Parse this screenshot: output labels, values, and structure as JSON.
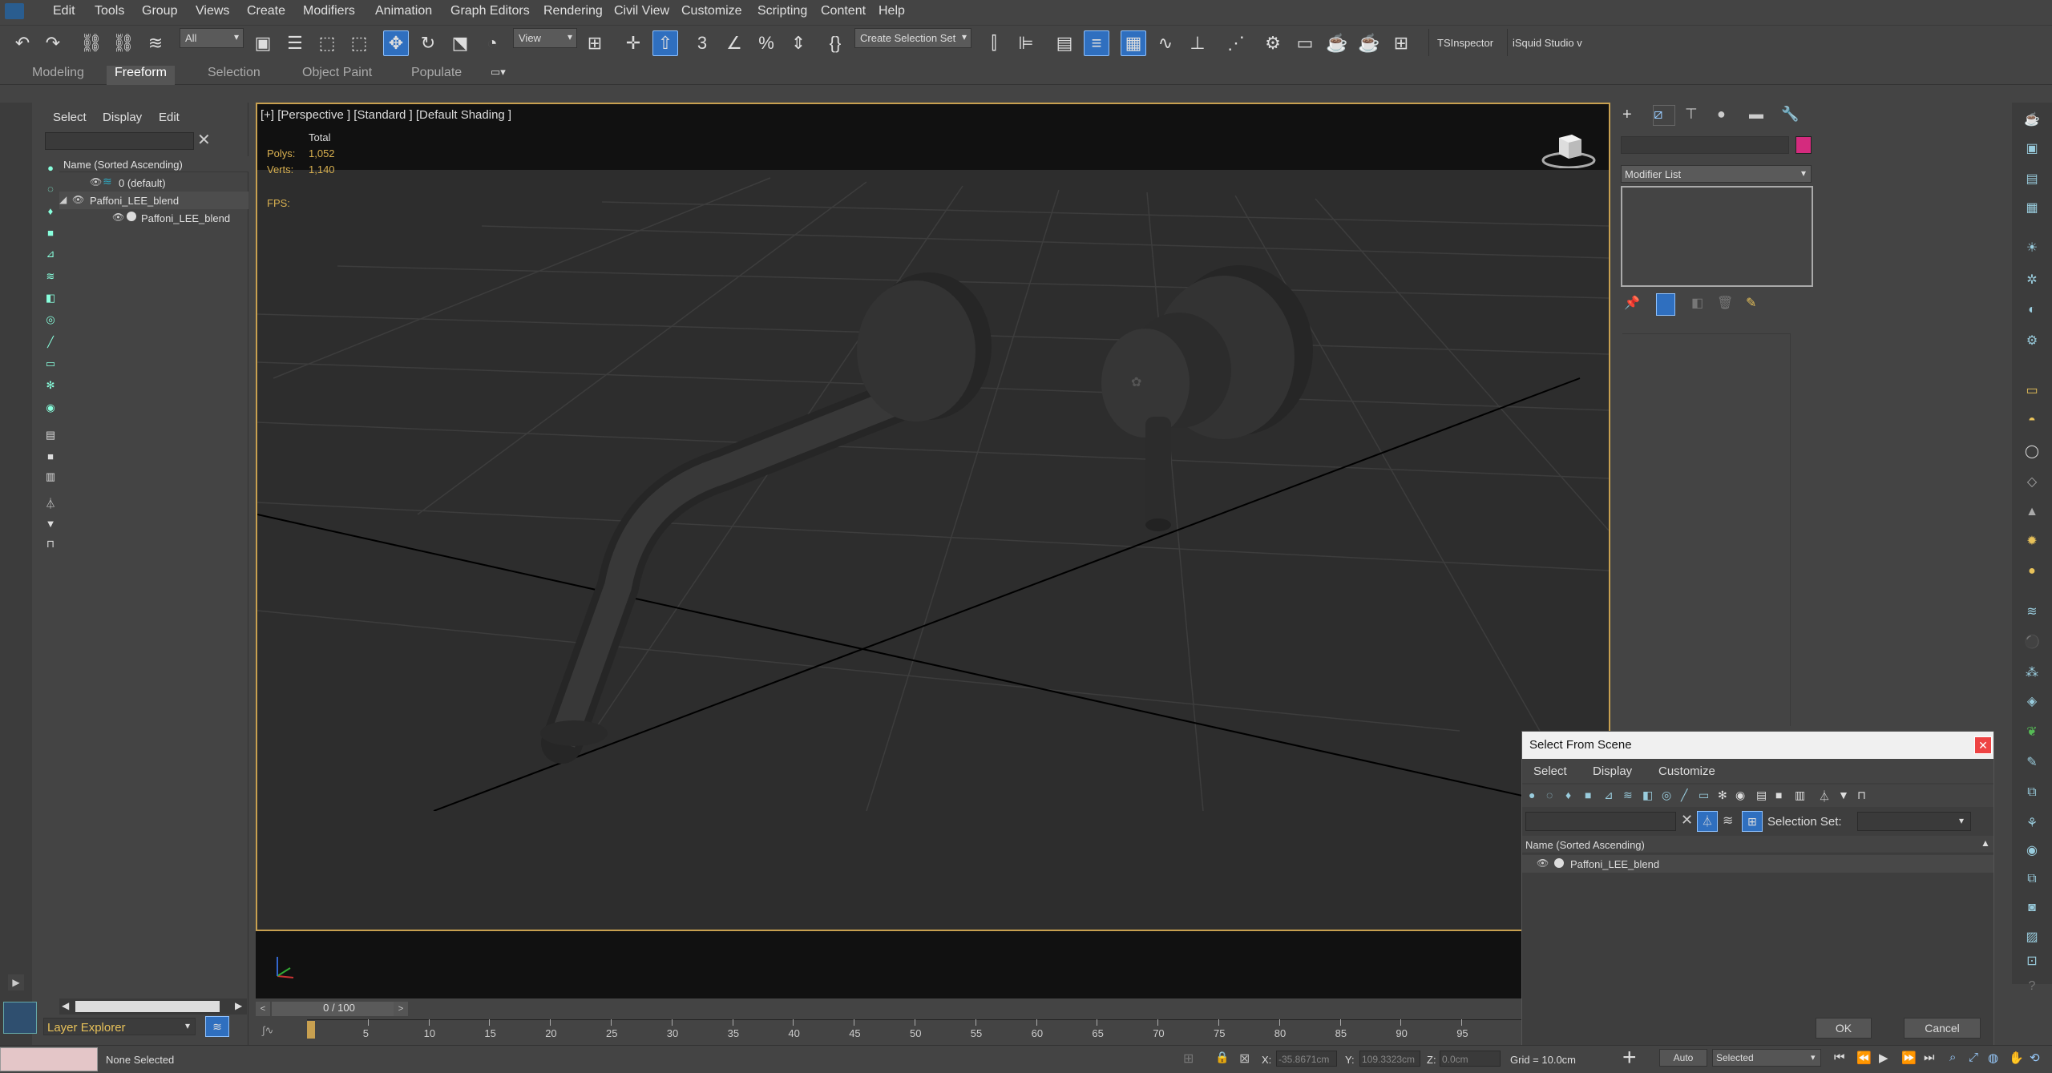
{
  "menubar": {
    "items": [
      "Edit",
      "Tools",
      "Group",
      "Views",
      "Create",
      "Modifiers",
      "Animation",
      "Graph Editors",
      "Rendering",
      "Civil View",
      "Customize",
      "Scripting",
      "Content",
      "Help"
    ]
  },
  "toolbar": {
    "filter_value": "All",
    "refcoord_value": "View",
    "selection_set_placeholder": "Create Selection Set",
    "plugin_1": "TSInspector",
    "plugin_2": "iSquid Studio v"
  },
  "ribbon": {
    "tabs": [
      "Modeling",
      "Freeform",
      "Selection",
      "Object Paint",
      "Populate"
    ],
    "active_tab": "Freeform"
  },
  "scene_explorer": {
    "menu": [
      "Select",
      "Display",
      "Edit"
    ],
    "column_header": "Name (Sorted Ascending)",
    "rows": [
      "0 (default)",
      "Paffoni_LEE_blend",
      "Paffoni_LEE_blend"
    ],
    "footer_label": "Layer Explorer"
  },
  "viewport": {
    "label": "[+] [Perspective ] [Standard ] [Default Shading ]",
    "stats_header": "Total",
    "polys_label": "Polys:",
    "polys_value": "1,052",
    "verts_label": "Verts:",
    "verts_value": "1,140",
    "fps_label": "FPS:"
  },
  "command_panel": {
    "modifier_list": "Modifier List",
    "accent_color": "#d42b7e"
  },
  "dialog": {
    "title": "Select From Scene",
    "menu": [
      "Select",
      "Display",
      "Customize"
    ],
    "selection_set_label": "Selection Set:",
    "column_header": "Name (Sorted Ascending)",
    "rows": [
      "Paffoni_LEE_blend"
    ],
    "ok": "OK",
    "cancel": "Cancel"
  },
  "timeline": {
    "frame_display": "0 / 100",
    "ticks": [
      "5",
      "10",
      "15",
      "20",
      "25",
      "30",
      "35",
      "40",
      "45",
      "50",
      "55",
      "60",
      "65",
      "70",
      "75",
      "80",
      "85",
      "90",
      "95"
    ]
  },
  "status": {
    "selection": "None Selected",
    "x_label": "X:",
    "x_value": "-35.8671cm",
    "y_label": "Y:",
    "y_value": "109.3323cm",
    "z_label": "Z:",
    "z_value": "0.0cm",
    "grid": "Grid = 10.0cm",
    "auto": "Auto",
    "key_mode": "Selected"
  }
}
